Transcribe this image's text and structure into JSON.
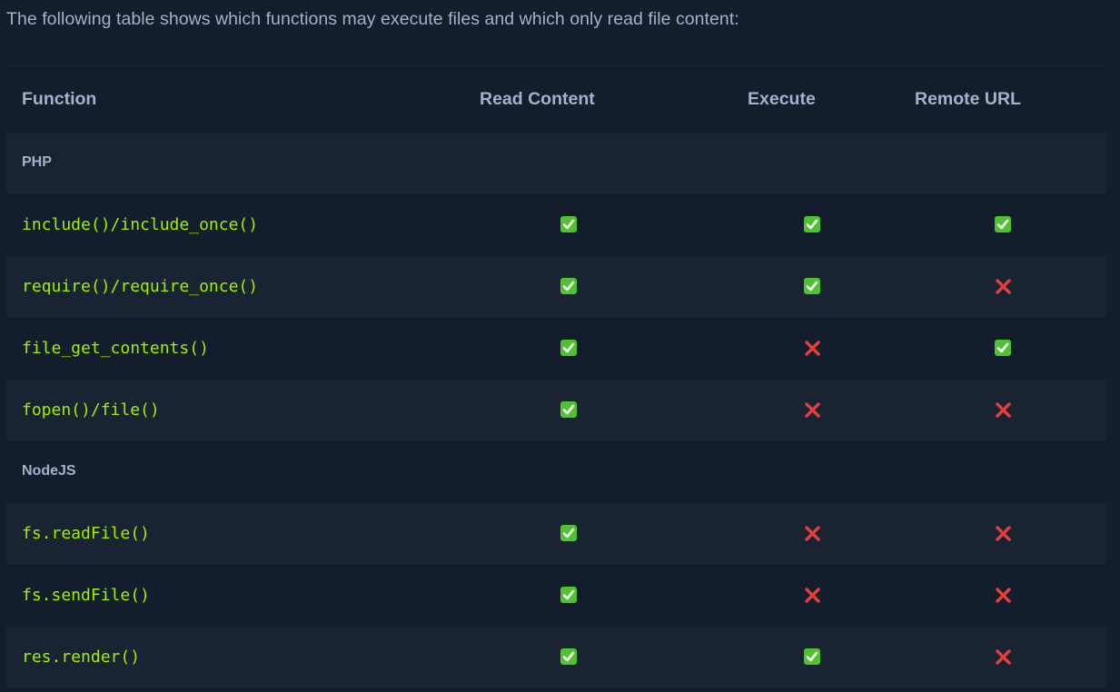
{
  "intro_text": "The following table shows which functions may execute files and which only read file content:",
  "headers": {
    "function": "Function",
    "read": "Read Content",
    "execute": "Execute",
    "remote": "Remote URL"
  },
  "groups": [
    {
      "name": "PHP",
      "rows": [
        {
          "function": "include()/include_once()",
          "read": true,
          "execute": true,
          "remote": true
        },
        {
          "function": "require()/require_once()",
          "read": true,
          "execute": true,
          "remote": false
        },
        {
          "function": "file_get_contents()",
          "read": true,
          "execute": false,
          "remote": true
        },
        {
          "function": "fopen()/file()",
          "read": true,
          "execute": false,
          "remote": false
        }
      ]
    },
    {
      "name": "NodeJS",
      "rows": [
        {
          "function": "fs.readFile()",
          "read": true,
          "execute": false,
          "remote": false
        },
        {
          "function": "fs.sendFile()",
          "read": true,
          "execute": false,
          "remote": false
        },
        {
          "function": "res.render()",
          "read": true,
          "execute": true,
          "remote": false
        }
      ]
    }
  ],
  "icons": {
    "yes": "check-mark-icon",
    "no": "cross-mark-icon"
  },
  "colors": {
    "background": "#141d2b",
    "row_alt": "#1a2332",
    "text": "#a4b1cd",
    "code": "#9fef00",
    "check": "#4ec22f",
    "cross": "#f23a3a"
  }
}
